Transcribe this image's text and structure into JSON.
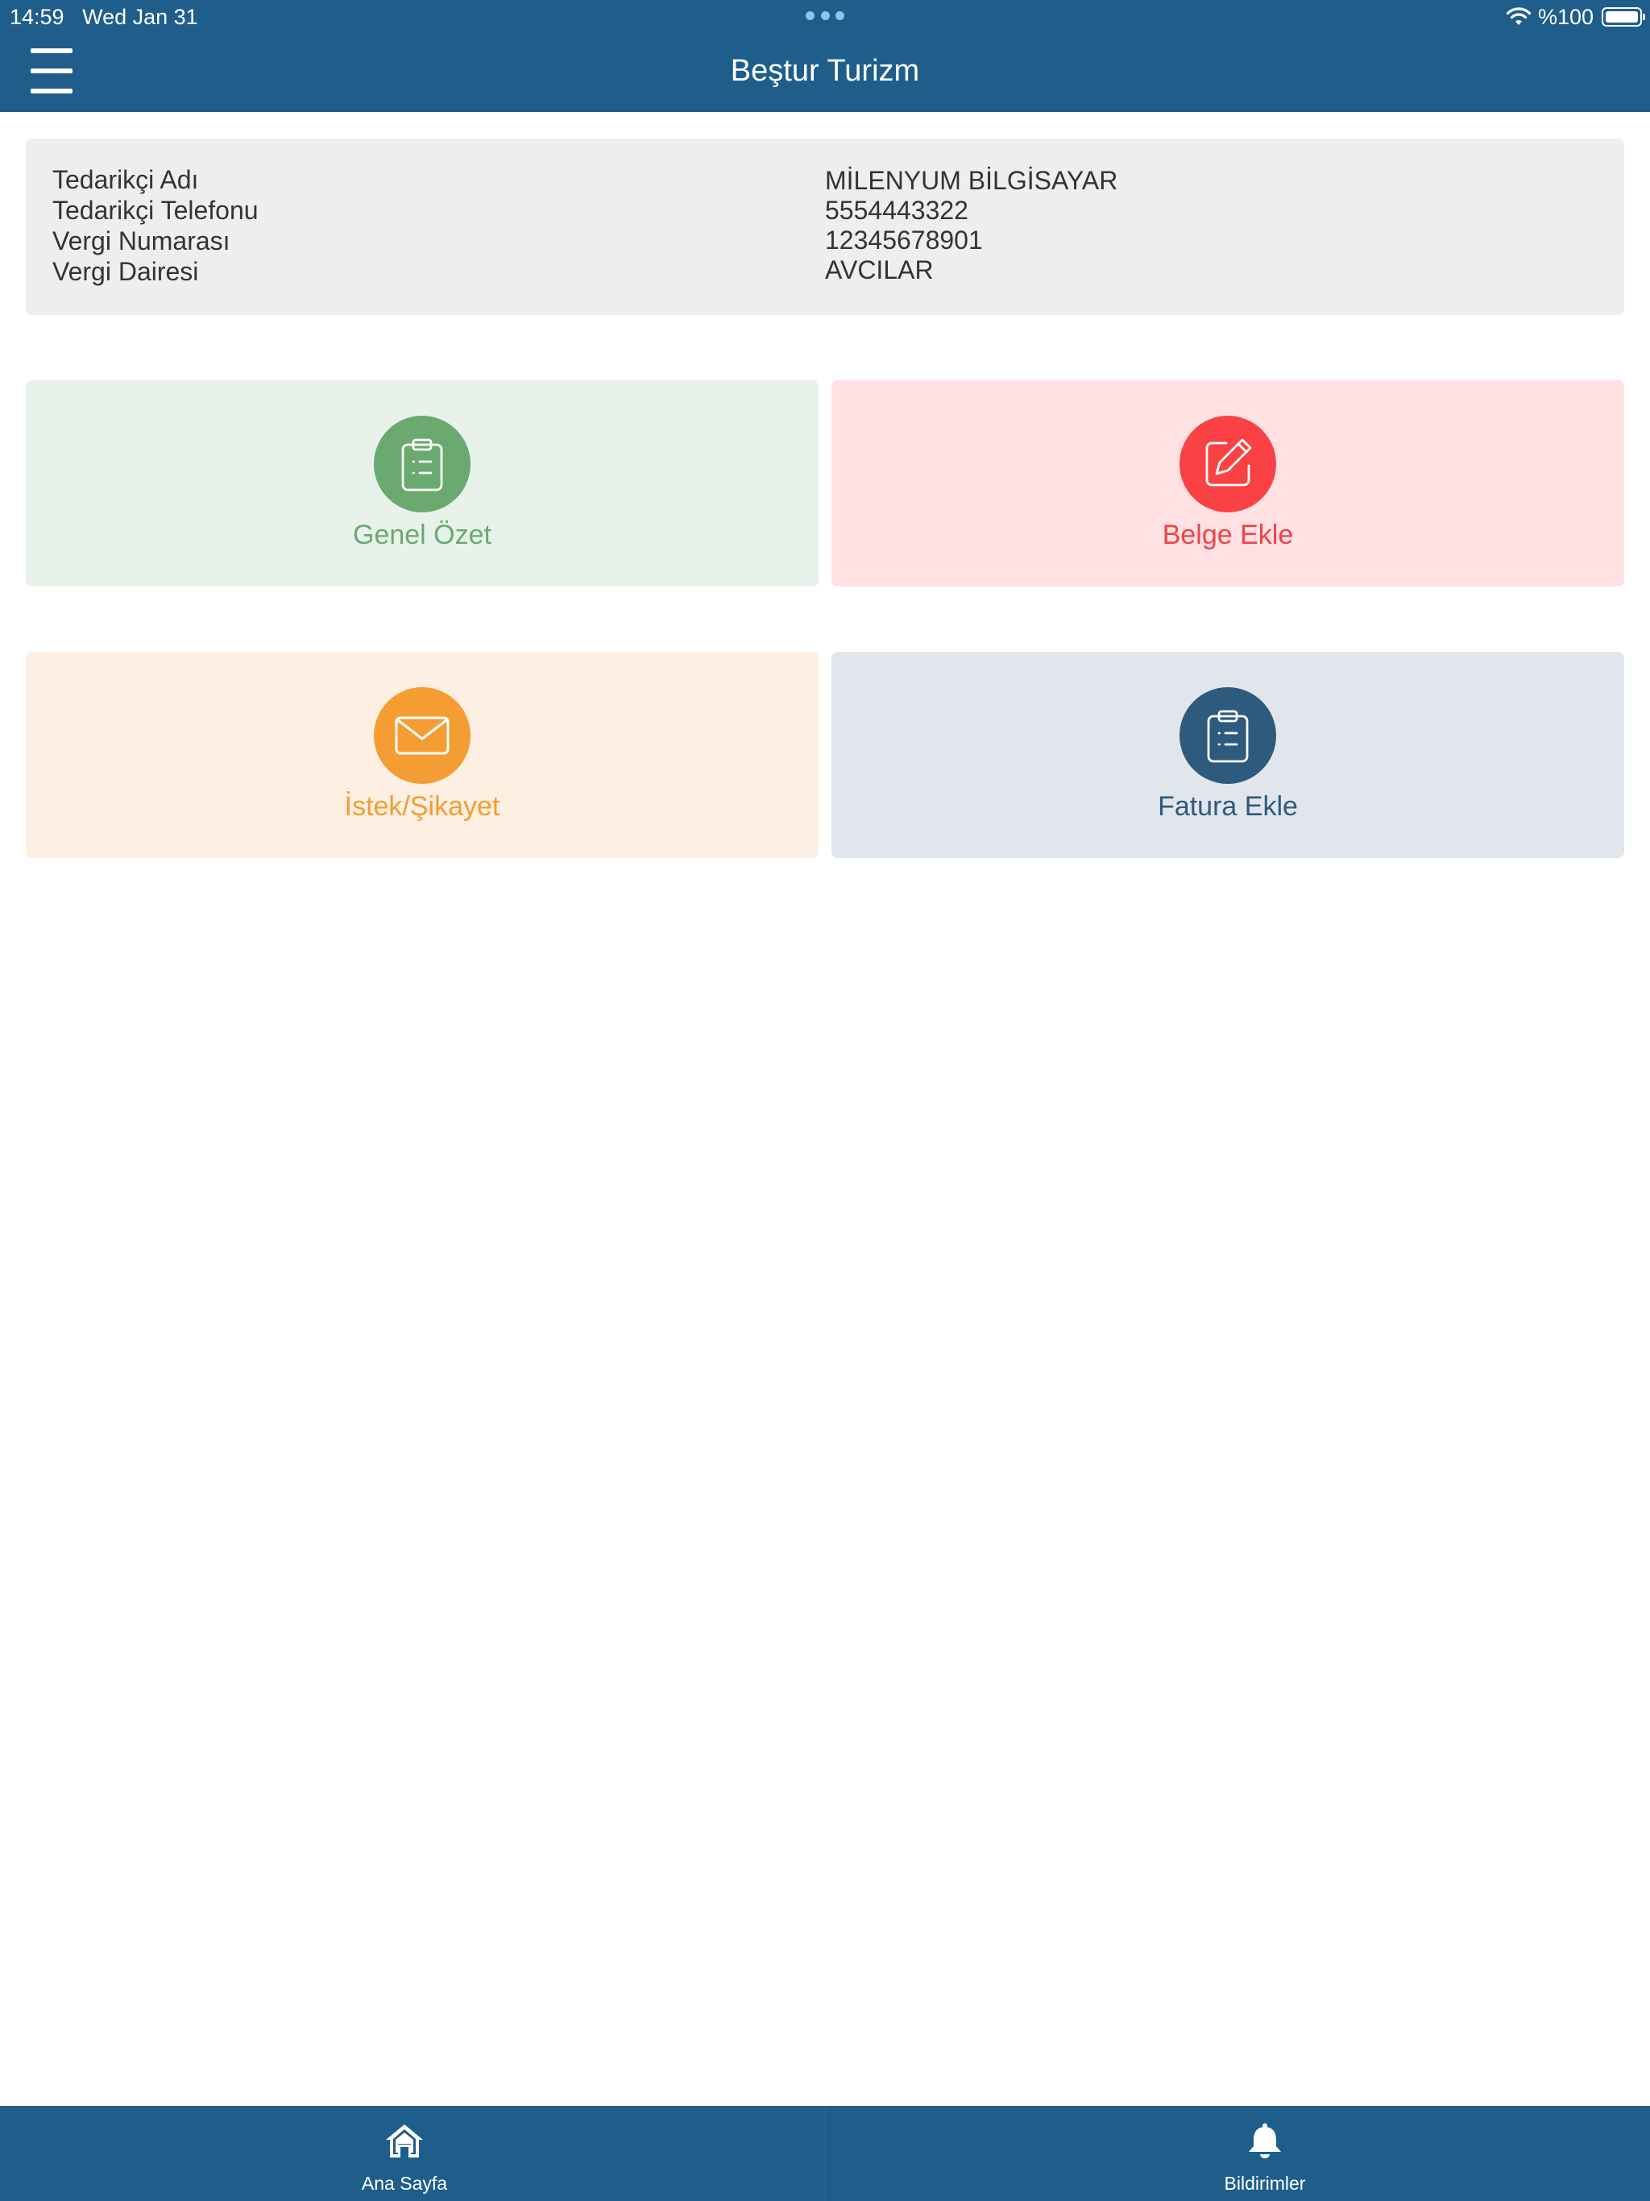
{
  "status_bar": {
    "time": "14:59",
    "date": "Wed Jan 31",
    "battery": "%100"
  },
  "header": {
    "title": "Beştur Turizm"
  },
  "supplier": {
    "labels": [
      "Tedarikçi Adı",
      "Tedarikçi Telefonu",
      "Vergi Numarası",
      "Vergi Dairesi"
    ],
    "values": [
      "MİLENYUM BİLGİSAYAR",
      "5554443322",
      "12345678901",
      "AVCILAR"
    ]
  },
  "tiles": {
    "genel_ozet": {
      "label": "Genel Özet",
      "icon": "clipboard-icon",
      "color": "#6aaa70"
    },
    "belge_ekle": {
      "label": "Belge Ekle",
      "icon": "edit-icon",
      "color": "#fa4245"
    },
    "istek_sikayet": {
      "label": "İstek/Şikayet",
      "icon": "envelope-icon",
      "color": "#f49d32"
    },
    "fatura_ekle": {
      "label": "Fatura Ekle",
      "icon": "clipboard-icon",
      "color": "#2e5a7d"
    }
  },
  "bottom_nav": {
    "home": {
      "label": "Ana Sayfa",
      "icon": "home-icon"
    },
    "notifications": {
      "label": "Bildirimler",
      "icon": "bell-icon"
    }
  },
  "colors": {
    "primary": "#1f5e8b",
    "info_card_bg": "#eeeeee"
  }
}
